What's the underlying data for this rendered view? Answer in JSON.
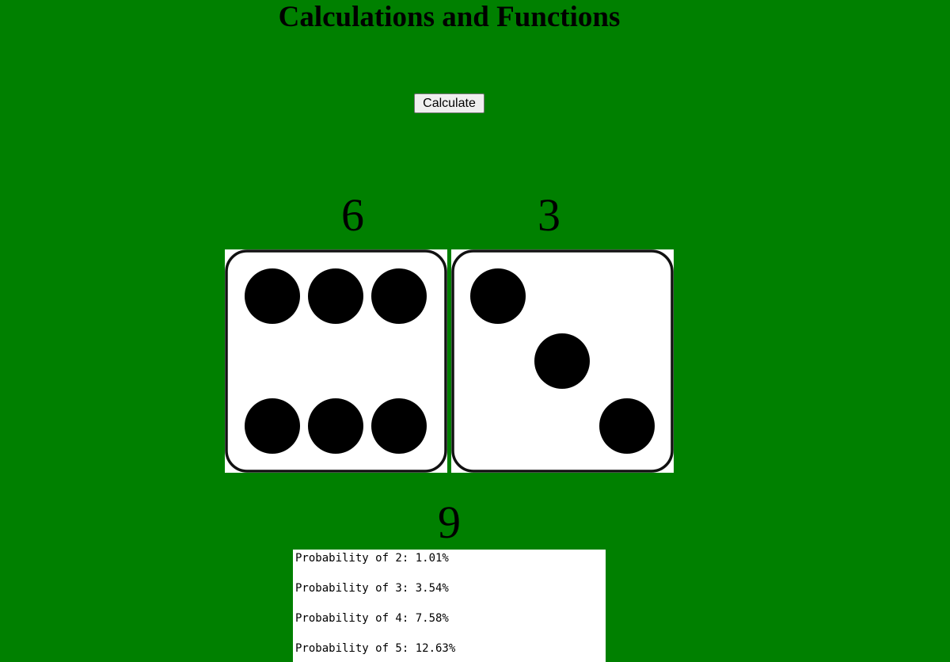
{
  "page": {
    "title": "Calculations and Functions"
  },
  "controls": {
    "calculate_label": "Calculate"
  },
  "dice": [
    {
      "value": "6",
      "pips": 6
    },
    {
      "value": "3",
      "pips": 3
    }
  ],
  "sum": "9",
  "probabilities": [
    "Probability of 2: 1.01%",
    "Probability of 3: 3.54%",
    "Probability of 4: 7.58%",
    "Probability of 5: 12.63%"
  ]
}
